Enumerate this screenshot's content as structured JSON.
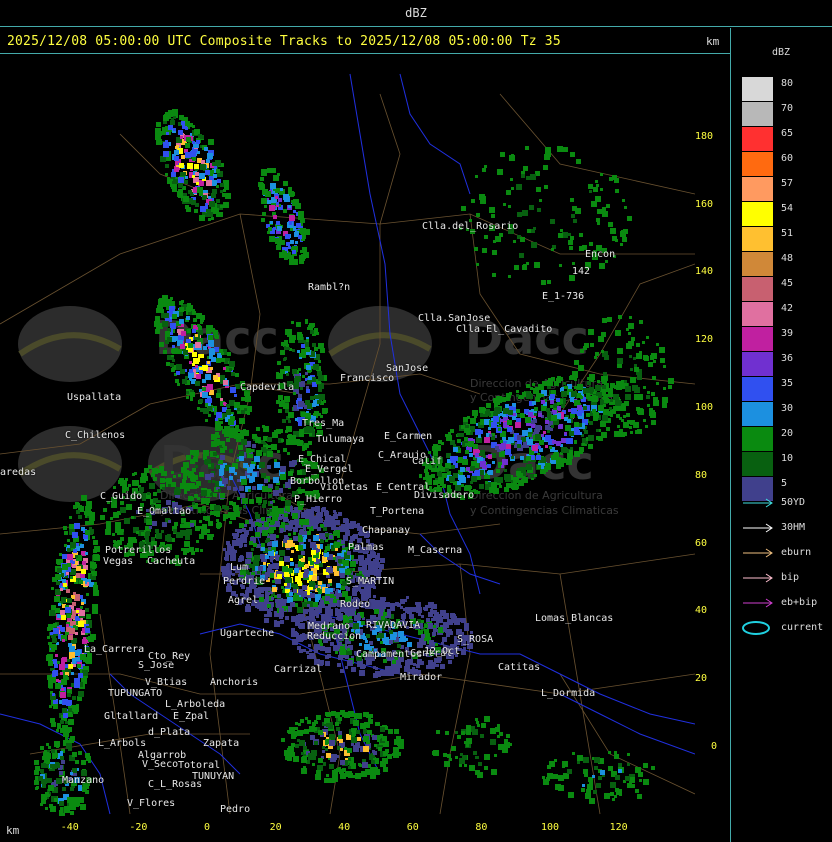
{
  "window": {
    "title": "dBZ"
  },
  "header": {
    "title": "2025/12/08 05:00:00 UTC Composite Tracks to 2025/12/08 05:00:00 Tz 35",
    "unit": "km"
  },
  "axes": {
    "x_unit": "km",
    "x_ticks": [
      -40,
      -20,
      0,
      20,
      40,
      60,
      80,
      100,
      120
    ],
    "y_ticks": [
      180,
      160,
      140,
      120,
      100,
      80,
      60,
      40,
      20,
      0
    ]
  },
  "legend": {
    "title": "dBZ",
    "levels": [
      {
        "label": "80",
        "color": "#d8d8d8"
      },
      {
        "label": "70",
        "color": "#b8b8b8"
      },
      {
        "label": "65",
        "color": "#ff3030"
      },
      {
        "label": "60",
        "color": "#ff6a10"
      },
      {
        "label": "57",
        "color": "#ff9a60"
      },
      {
        "label": "54",
        "color": "#ffff00"
      },
      {
        "label": "51",
        "color": "#ffc030"
      },
      {
        "label": "48",
        "color": "#d08838"
      },
      {
        "label": "45",
        "color": "#c86070"
      },
      {
        "label": "42",
        "color": "#e070a0"
      },
      {
        "label": "39",
        "color": "#c020a0"
      },
      {
        "label": "36",
        "color": "#7030d0"
      },
      {
        "label": "35",
        "color": "#3050f0"
      },
      {
        "label": "30",
        "color": "#1c90e0"
      },
      {
        "label": "20",
        "color": "#0a8a10"
      },
      {
        "label": "10",
        "color": "#086010"
      },
      {
        "label": "5",
        "color": "#40408c"
      }
    ],
    "tracks": [
      {
        "label": "50YD",
        "color": "#40e0e0"
      },
      {
        "label": "30HM",
        "color": "#ffffff"
      },
      {
        "label": "eburn",
        "color": "#f0c080"
      },
      {
        "label": "bip",
        "color": "#ffc0d0"
      },
      {
        "label": "eb+bip",
        "color": "#d040d0"
      },
      {
        "label": "current",
        "color": "#20d0e0"
      }
    ]
  },
  "places": [
    {
      "name": "Clla.del_Rosario"
    },
    {
      "name": "Encon"
    },
    {
      "name": "142"
    },
    {
      "name": "E_1-736"
    },
    {
      "name": "Rambl?n"
    },
    {
      "name": "Clla.SanJose"
    },
    {
      "name": "Clla.El_Cavadito"
    },
    {
      "name": "Uspallata"
    },
    {
      "name": "Capdevila"
    },
    {
      "name": "Francisco"
    },
    {
      "name": "SanJose"
    },
    {
      "name": "C_Chilenos"
    },
    {
      "name": "Tres_Ma"
    },
    {
      "name": "Tulumaya"
    },
    {
      "name": "E_Carmen"
    },
    {
      "name": "aredas"
    },
    {
      "name": "E_Chical"
    },
    {
      "name": "C_Araujo"
    },
    {
      "name": "E_Vergel"
    },
    {
      "name": "Calif"
    },
    {
      "name": "Borbollon"
    },
    {
      "name": "Violetas"
    },
    {
      "name": "E_Central"
    },
    {
      "name": "C_Guido"
    },
    {
      "name": "P_Hierro"
    },
    {
      "name": "Divisadero"
    },
    {
      "name": "E_Omaltao"
    },
    {
      "name": "T_Portena"
    },
    {
      "name": "Chapanay"
    },
    {
      "name": "Potrerillos"
    },
    {
      "name": "Cacheuta"
    },
    {
      "name": "Vegas"
    },
    {
      "name": "Lum"
    },
    {
      "name": "Palmas"
    },
    {
      "name": "M_Caserna"
    },
    {
      "name": "Perdrie"
    },
    {
      "name": "S_MARTIN"
    },
    {
      "name": "Agrel"
    },
    {
      "name": "Rodeo"
    },
    {
      "name": "Ugarteche"
    },
    {
      "name": "Lomas_Blancas"
    },
    {
      "name": "Medrano"
    },
    {
      "name": "RIVADAVIA"
    },
    {
      "name": "Reduccion"
    },
    {
      "name": "S_ROSA"
    },
    {
      "name": "La_Carrera"
    },
    {
      "name": "Cto_Rey"
    },
    {
      "name": "S_Jose"
    },
    {
      "name": "Campamentos"
    },
    {
      "name": "Central"
    },
    {
      "name": "Catitas"
    },
    {
      "name": "Carrizal"
    },
    {
      "name": "12_Oct"
    },
    {
      "name": "Anchoris"
    },
    {
      "name": "Mirador"
    },
    {
      "name": "V_Btias"
    },
    {
      "name": "TUPUNGATO"
    },
    {
      "name": "L_Dormida"
    },
    {
      "name": "L_Arboleda"
    },
    {
      "name": "Gltallard"
    },
    {
      "name": "E_Zpal"
    },
    {
      "name": "d_Plata"
    },
    {
      "name": "Zapata"
    },
    {
      "name": "L_Arbols"
    },
    {
      "name": "Algarrob"
    },
    {
      "name": "V_Seco"
    },
    {
      "name": "Totoral"
    },
    {
      "name": "TUNUYAN"
    },
    {
      "name": "Manzano"
    },
    {
      "name": "C_L_Rosas"
    },
    {
      "name": "V_Flores"
    },
    {
      "name": "Pedro"
    }
  ],
  "watermark": {
    "brand": "Dacc",
    "line1": "Direccion de Agricultura",
    "line2": "y Contingencias Climaticas"
  }
}
